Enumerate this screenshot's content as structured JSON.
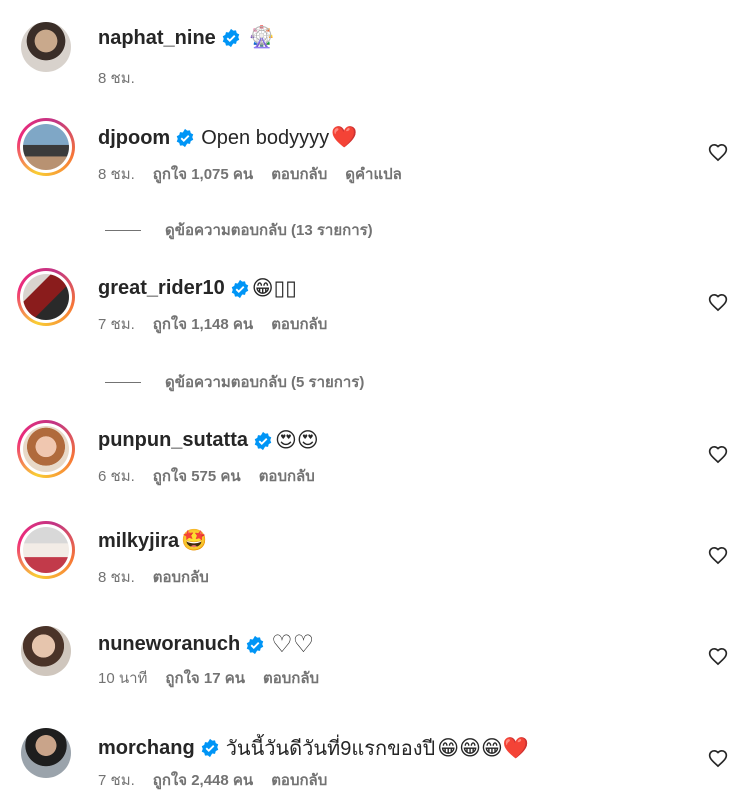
{
  "colors": {
    "primary_text": "#262626",
    "secondary_text": "#737373",
    "verified": "#0095f6",
    "heart_red": "#e0101d"
  },
  "post": {
    "username": "naphat_nine",
    "verified": true,
    "emoji": "🎡",
    "time": "8 ชม."
  },
  "comments": [
    {
      "username": "djpoom",
      "verified": true,
      "text": "Open bodyyyy",
      "emoji": "❤️",
      "time": "8 ชม.",
      "likes": "ถูกใจ 1,075 คน",
      "reply": "ตอบกลับ",
      "translate": "ดูคำแปล",
      "view_replies": "ดูข้อความตอบกลับ (13 รายการ)"
    },
    {
      "username": "great_rider10",
      "verified": true,
      "text": "😁▯▯",
      "time": "7 ชม.",
      "likes": "ถูกใจ 1,148 คน",
      "reply": "ตอบกลับ",
      "view_replies": "ดูข้อความตอบกลับ (5 รายการ)"
    },
    {
      "username": "punpun_sutatta",
      "verified": true,
      "text": "😍😍",
      "time": "6 ชม.",
      "likes": "ถูกใจ 575 คน",
      "reply": "ตอบกลับ"
    },
    {
      "username": "milkyjira",
      "verified": false,
      "text": "🤩",
      "time": "8 ชม.",
      "reply": "ตอบกลับ"
    },
    {
      "username": "nuneworanuch",
      "verified": true,
      "text": "♡♡",
      "time": "10 นาที",
      "likes": "ถูกใจ 17 คน",
      "reply": "ตอบกลับ"
    },
    {
      "username": "morchang",
      "verified": true,
      "text": "วันนี้วันดีวันที่9แรกของปี",
      "emoji": "😁😁😁❤️",
      "time": "7 ชม.",
      "likes": "ถูกใจ 2,448 คน",
      "reply": "ตอบกลับ"
    }
  ]
}
